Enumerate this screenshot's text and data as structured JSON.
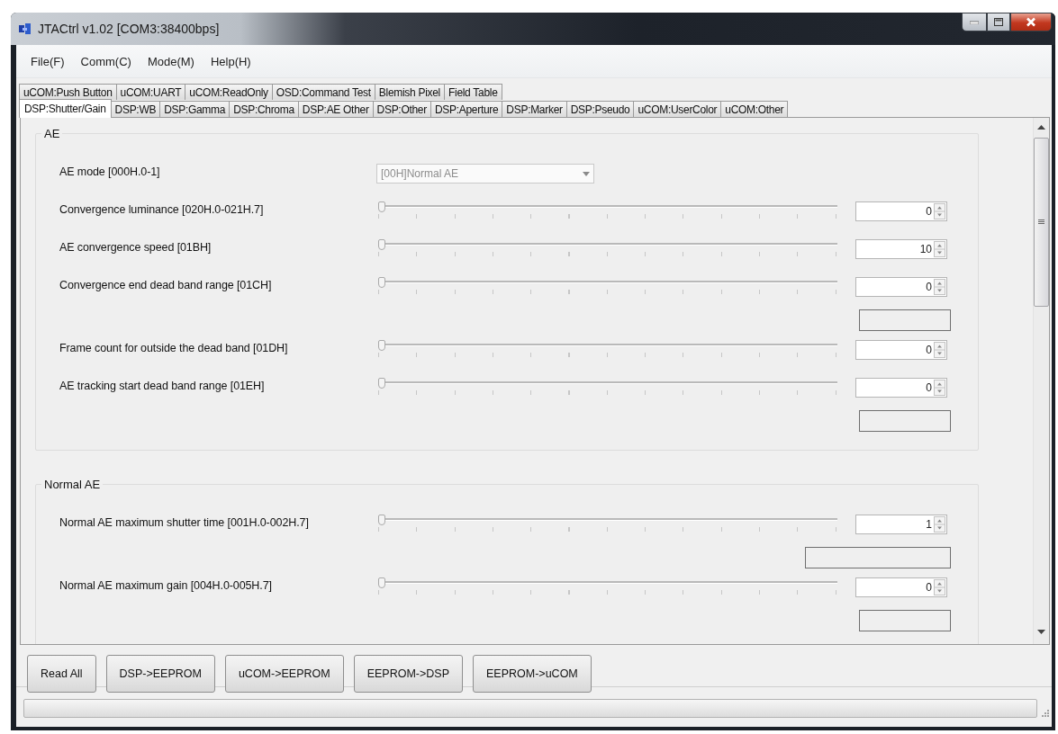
{
  "window": {
    "title": "JTACtrl v1.02 [COM3:38400bps]"
  },
  "menu": [
    "File(F)",
    "Comm(C)",
    "Mode(M)",
    "Help(H)"
  ],
  "tab_rows": [
    [
      {
        "label": "uCOM:Push Button",
        "selected": false
      },
      {
        "label": "uCOM:UART",
        "selected": false
      },
      {
        "label": "uCOM:ReadOnly",
        "selected": false
      },
      {
        "label": "OSD:Command Test",
        "selected": false
      },
      {
        "label": "Blemish Pixel",
        "selected": false
      },
      {
        "label": "Field Table",
        "selected": false
      }
    ],
    [
      {
        "label": "DSP:Shutter/Gain",
        "selected": true
      },
      {
        "label": "DSP:WB",
        "selected": false
      },
      {
        "label": "DSP:Gamma",
        "selected": false
      },
      {
        "label": "DSP:Chroma",
        "selected": false
      },
      {
        "label": "DSP:AE Other",
        "selected": false
      },
      {
        "label": "DSP:Other",
        "selected": false
      },
      {
        "label": "DSP:Aperture",
        "selected": false
      },
      {
        "label": "DSP:Marker",
        "selected": false
      },
      {
        "label": "DSP:Pseudo",
        "selected": false
      },
      {
        "label": "uCOM:UserColor",
        "selected": false
      },
      {
        "label": "uCOM:Other",
        "selected": false
      }
    ]
  ],
  "groups": [
    {
      "title": "AE",
      "rows": [
        {
          "kind": "combo",
          "label": "AE mode [000H.0-1]",
          "value": "[00H]Normal AE",
          "disabled": true
        },
        {
          "kind": "slider",
          "label": "Convergence luminance [020H.0-021H.7]",
          "level": 0,
          "value": "0"
        },
        {
          "kind": "slider",
          "label": "AE convergence speed [01BH]",
          "level": 0,
          "value": "10"
        },
        {
          "kind": "slider",
          "label": "Convergence end dead band range [01CH]",
          "level": 0,
          "value": "0",
          "readout_box": true,
          "readout_wide": false
        },
        {
          "kind": "slider",
          "label": "Frame count for outside the dead band [01DH]",
          "level": 0,
          "value": "0"
        },
        {
          "kind": "slider",
          "label": "AE tracking start dead band range [01EH]",
          "level": 0,
          "value": "0",
          "readout_box": true,
          "readout_wide": false
        }
      ]
    },
    {
      "title": "Normal AE",
      "rows": [
        {
          "kind": "slider",
          "label": "Normal AE maximum shutter time [001H.0-002H.7]",
          "level": 0,
          "value": "1",
          "readout_box": true,
          "readout_wide": true
        },
        {
          "kind": "slider",
          "label": "Normal AE maximum gain [004H.0-005H.7]",
          "level": 0,
          "value": "0",
          "readout_box": true,
          "readout_wide": false
        }
      ]
    }
  ],
  "buttons": [
    "Read All",
    "DSP->EEPROM",
    "uCOM->EEPROM",
    "EEPROM->DSP",
    "EEPROM->uCOM"
  ]
}
